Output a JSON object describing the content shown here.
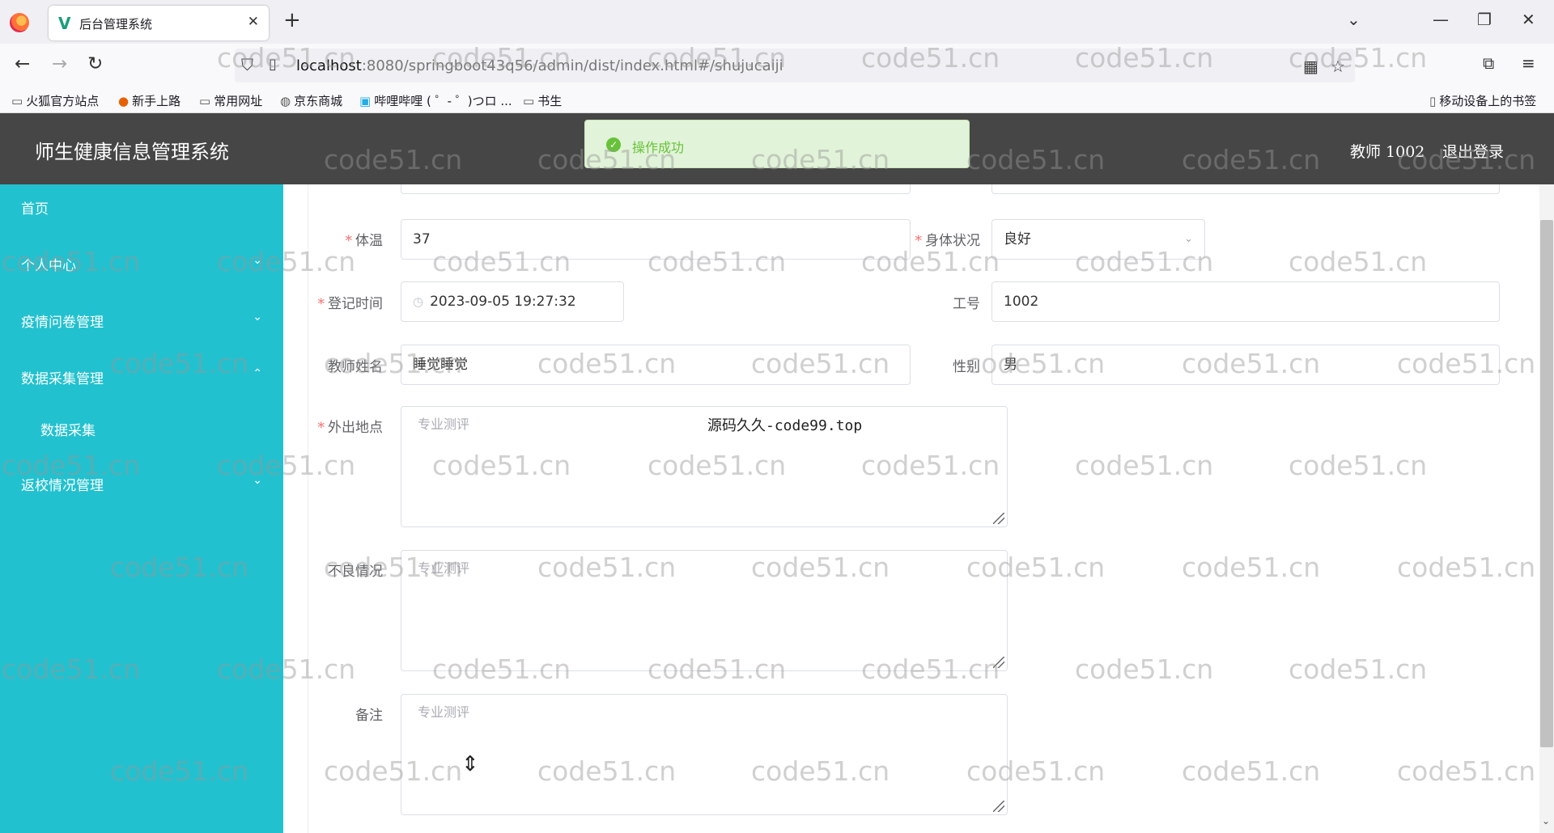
{
  "browser": {
    "tab_title": "后台管理系统",
    "tab_icon": "vue-logo-icon",
    "url_host": "localhost",
    "url_rest": ":8080/springboot43q56/admin/dist/index.html#/shujucaiji",
    "bookmarks": [
      "火狐官方站点",
      "新手上路",
      "常用网址",
      "京东商城",
      "哔哩哔哩 ( ゜- ゜)つロ ...",
      "书生"
    ],
    "mobile_bookmarks": "移动设备上的书签"
  },
  "app": {
    "title": "师生健康信息管理系统",
    "user": "教师 1002",
    "logout": "退出登录",
    "toast": "操作成功"
  },
  "sidebar": {
    "items": [
      {
        "label": "首页"
      },
      {
        "label": "个人中心"
      },
      {
        "label": "疫情问卷管理"
      },
      {
        "label": "数据采集管理"
      },
      {
        "label": "数据采集"
      },
      {
        "label": "返校情况管理"
      }
    ]
  },
  "form": {
    "temperature": {
      "label": "体温",
      "value": "37"
    },
    "health": {
      "label": "身体状况",
      "value": "良好"
    },
    "register_time": {
      "label": "登记时间",
      "value": "2023-09-05 19:27:32"
    },
    "job_number": {
      "label": "工号",
      "value": "1002"
    },
    "teacher_name": {
      "label": "教师姓名",
      "value": "睡觉睡觉"
    },
    "gender": {
      "label": "性别",
      "value": "男"
    },
    "outing": {
      "label": "外出地点",
      "placeholder": "专业测评"
    },
    "bad_condition": {
      "label": "不良情况",
      "placeholder": "专业测评"
    },
    "remarks": {
      "label": "备注",
      "placeholder": "专业测评"
    }
  },
  "overlay_text": "源码久久-code99.top",
  "watermark": "code51.cn",
  "colors": {
    "sidebar": "#22c1cf",
    "header": "#464646",
    "required": "#f56c6c",
    "success": "#67c23a"
  }
}
